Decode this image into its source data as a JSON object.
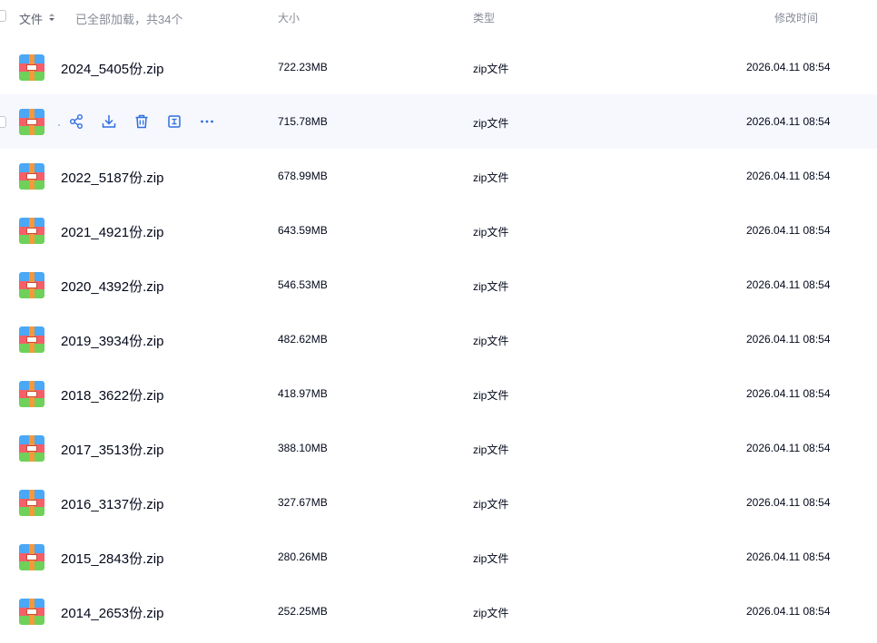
{
  "header": {
    "name_col": "文件",
    "loaded_text": "已全部加载，共34个",
    "size_col": "大小",
    "type_col": "类型",
    "time_col": "修改时间"
  },
  "actions": {
    "share": "share-icon",
    "download": "download-icon",
    "delete": "trash-icon",
    "rename": "rename-icon",
    "more": "more-icon"
  },
  "files": [
    {
      "name": "2024_5405份.zip",
      "size": "722.23MB",
      "type": "zip文件",
      "modified": "2026.04.11 08:54"
    },
    {
      "name": "",
      "size": "715.78MB",
      "type": "zip文件",
      "modified": "2026.04.11 08:54"
    },
    {
      "name": "2022_5187份.zip",
      "size": "678.99MB",
      "type": "zip文件",
      "modified": "2026.04.11 08:54"
    },
    {
      "name": "2021_4921份.zip",
      "size": "643.59MB",
      "type": "zip文件",
      "modified": "2026.04.11 08:54"
    },
    {
      "name": "2020_4392份.zip",
      "size": "546.53MB",
      "type": "zip文件",
      "modified": "2026.04.11 08:54"
    },
    {
      "name": "2019_3934份.zip",
      "size": "482.62MB",
      "type": "zip文件",
      "modified": "2026.04.11 08:54"
    },
    {
      "name": "2018_3622份.zip",
      "size": "418.97MB",
      "type": "zip文件",
      "modified": "2026.04.11 08:54"
    },
    {
      "name": "2017_3513份.zip",
      "size": "388.10MB",
      "type": "zip文件",
      "modified": "2026.04.11 08:54"
    },
    {
      "name": "2016_3137份.zip",
      "size": "327.67MB",
      "type": "zip文件",
      "modified": "2026.04.11 08:54"
    },
    {
      "name": "2015_2843份.zip",
      "size": "280.26MB",
      "type": "zip文件",
      "modified": "2026.04.11 08:54"
    },
    {
      "name": "2014_2653份.zip",
      "size": "252.25MB",
      "type": "zip文件",
      "modified": "2026.04.11 08:54"
    }
  ],
  "colors": {
    "accent": "#2f6fe0",
    "hover_row": "#f6f8fe",
    "muted_text": "#878b97"
  }
}
